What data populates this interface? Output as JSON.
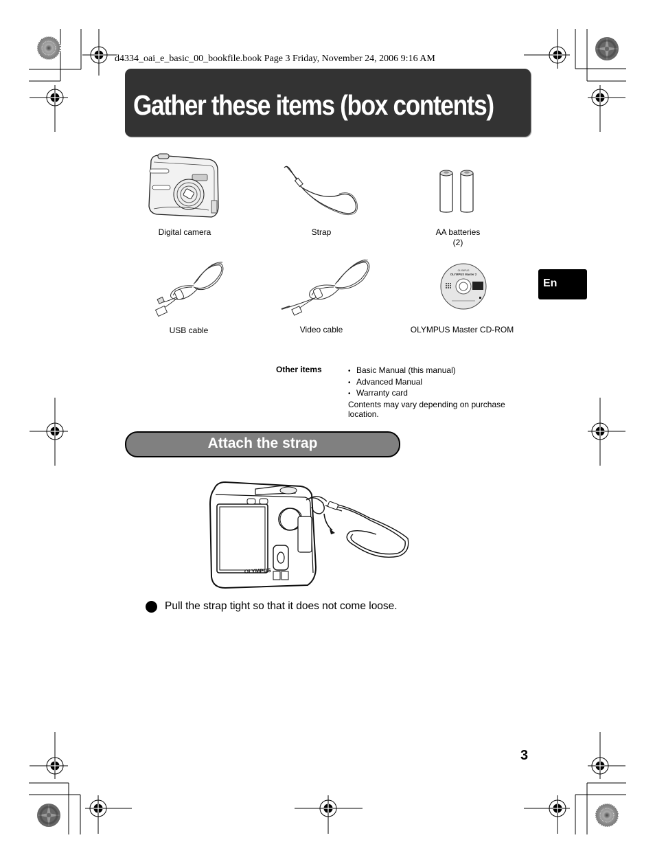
{
  "header": {
    "print_info": "d4334_oai_e_basic_00_bookfile.book  Page 3  Friday, November 24, 2006  9:16 AM"
  },
  "title": "Gather these items (box contents)",
  "box_contents": [
    {
      "label": "Digital camera",
      "icon": "digital-camera-illustration"
    },
    {
      "label": "Strap",
      "icon": "strap-illustration"
    },
    {
      "label": "AA batteries",
      "sub": "(2)",
      "icon": "aa-batteries-illustration"
    },
    {
      "label": "USB cable",
      "icon": "usb-cable-illustration"
    },
    {
      "label": "Video cable",
      "icon": "video-cable-illustration"
    },
    {
      "label": "OLYMPUS Master CD-ROM",
      "icon": "cd-rom-illustration"
    }
  ],
  "language_tab": "En",
  "other_items": {
    "label": "Other items",
    "items": [
      "Basic Manual (this manual)",
      "Advanced Manual",
      "Warranty card"
    ],
    "note": "Contents may vary depending on purchase location."
  },
  "section": {
    "title": "Attach the strap",
    "illustration": "camera-with-strap-illustration",
    "camera_brand": "OLYMPUS",
    "note": "Pull the strap tight so that it does not come loose."
  },
  "page_number": "3"
}
